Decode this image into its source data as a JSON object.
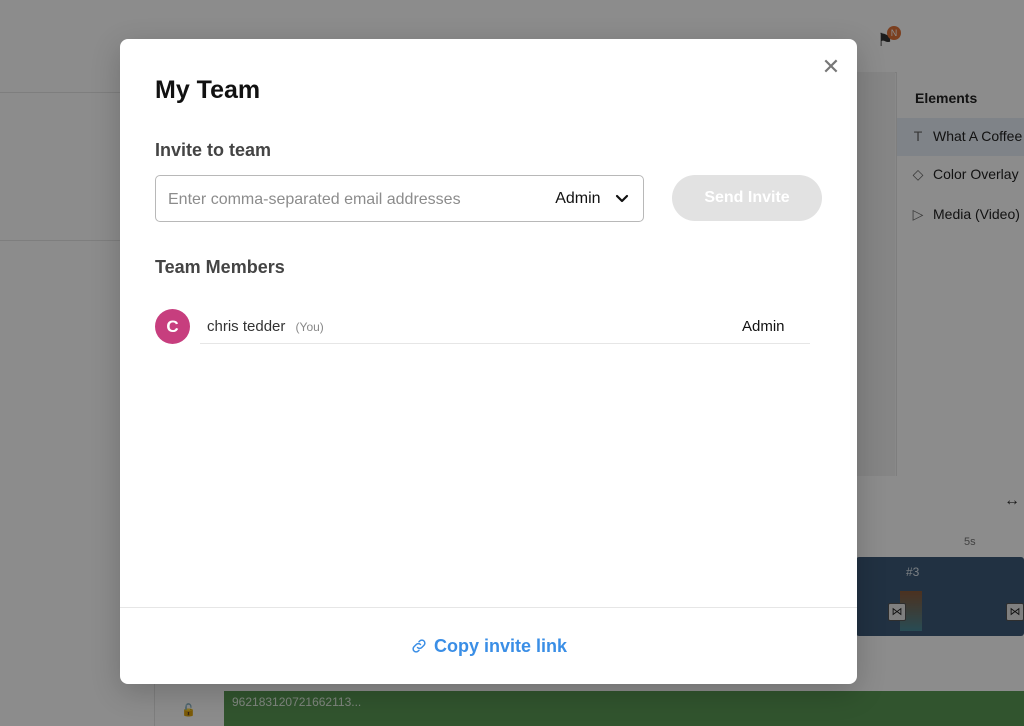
{
  "background": {
    "right_panel": {
      "title": "Elements",
      "items": [
        {
          "icon": "text-icon",
          "label": "What A Coffee"
        },
        {
          "icon": "diamond-icon",
          "label": "Color Overlay"
        },
        {
          "icon": "play-icon",
          "label": "Media (Video)"
        }
      ]
    },
    "notification_badge": "N",
    "timeline": {
      "ruler_label": "5s",
      "clip_label": "#3",
      "audio_track_label": "962183120721662113..."
    }
  },
  "modal": {
    "title": "My Team",
    "invite_section_title": "Invite to team",
    "email_placeholder": "Enter comma-separated email addresses",
    "email_value": "",
    "role_selected": "Admin",
    "send_button_label": "Send Invite",
    "members_section_title": "Team Members",
    "members": [
      {
        "initial": "C",
        "name": "chris tedder",
        "you_tag": "(You)",
        "role": "Admin",
        "avatar_color": "#c73e7e"
      }
    ],
    "copy_link_label": "Copy invite link"
  },
  "colors": {
    "accent_link": "#3a8ee6",
    "send_disabled_bg": "#e2e2e2"
  }
}
